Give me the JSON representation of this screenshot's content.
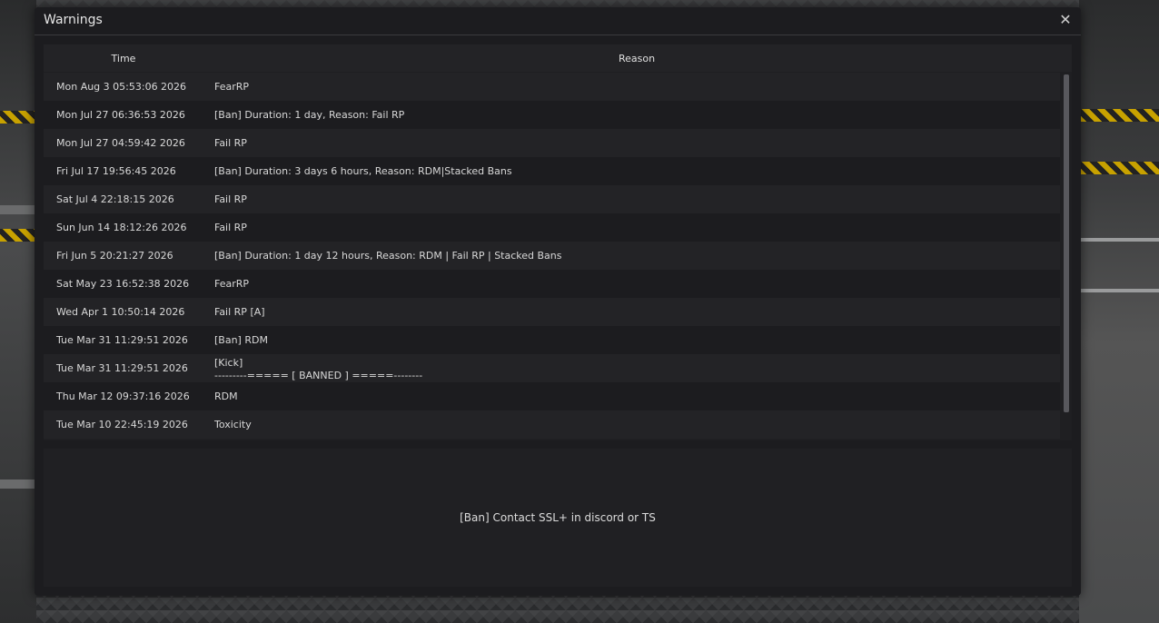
{
  "window": {
    "title": "Warnings",
    "close_glyph": "✕"
  },
  "table": {
    "columns": [
      "Time",
      "Reason"
    ],
    "rows": [
      {
        "time": "Mon Aug  3 05:53:06 2026",
        "reason": "FearRP"
      },
      {
        "time": "Mon Jul 27 06:36:53 2026",
        "reason": "[Ban] Duration:  1 day, Reason: Fail RP"
      },
      {
        "time": "Mon Jul 27 04:59:42 2026",
        "reason": "Fail RP"
      },
      {
        "time": "Fri Jul 17 19:56:45 2026",
        "reason": "[Ban] Duration:  3 days 6 hours, Reason: RDM|Stacked Bans"
      },
      {
        "time": "Sat Jul  4 22:18:15 2026",
        "reason": "Fail RP"
      },
      {
        "time": "Sun Jun 14 18:12:26 2026",
        "reason": "Fail RP"
      },
      {
        "time": "Fri Jun  5 20:21:27 2026",
        "reason": "[Ban] Duration:  1 day 12 hours, Reason: RDM | Fail RP | Stacked Bans"
      },
      {
        "time": "Sat May 23 16:52:38 2026",
        "reason": "FearRP"
      },
      {
        "time": "Wed Apr  1 10:50:14 2026",
        "reason": "Fail RP [A]"
      },
      {
        "time": "Tue Mar 31 11:29:51 2026",
        "reason": "[Ban] RDM"
      },
      {
        "time": "Tue Mar 31 11:29:51 2026",
        "reason": "[Kick]\n---------===== [ BANNED ] =====--------"
      },
      {
        "time": "Thu Mar 12 09:37:16 2026",
        "reason": "RDM"
      },
      {
        "time": "Tue Mar 10 22:45:19 2026",
        "reason": "Toxicity"
      }
    ]
  },
  "detail": {
    "text": "[Ban] Contact SSL+ in discord or TS"
  },
  "colors": {
    "window_bg": "#1c1c1f",
    "row_odd": "#232326",
    "row_even": "#1c1c1f",
    "text": "#d8d8d8"
  }
}
